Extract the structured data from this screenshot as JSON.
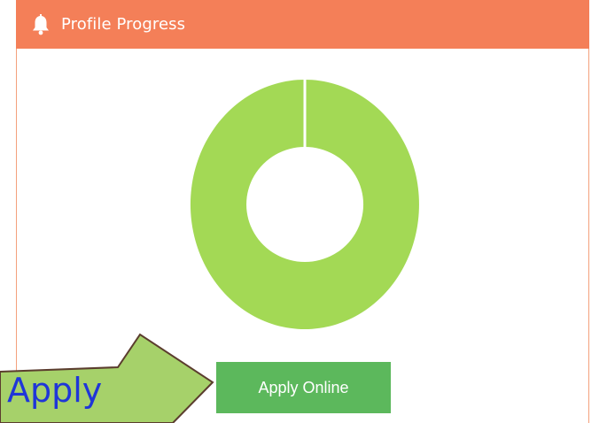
{
  "panel": {
    "title": "Profile Progress",
    "header_color": "#f47f58",
    "icon": "bell-icon"
  },
  "progress": {
    "percent": 100,
    "fill_color": "#a3d955"
  },
  "actions": {
    "apply_label": "Apply Online",
    "apply_color": "#5cb85c"
  },
  "annotation": {
    "text": "Apply",
    "arrow_color": "#a6d16a"
  }
}
